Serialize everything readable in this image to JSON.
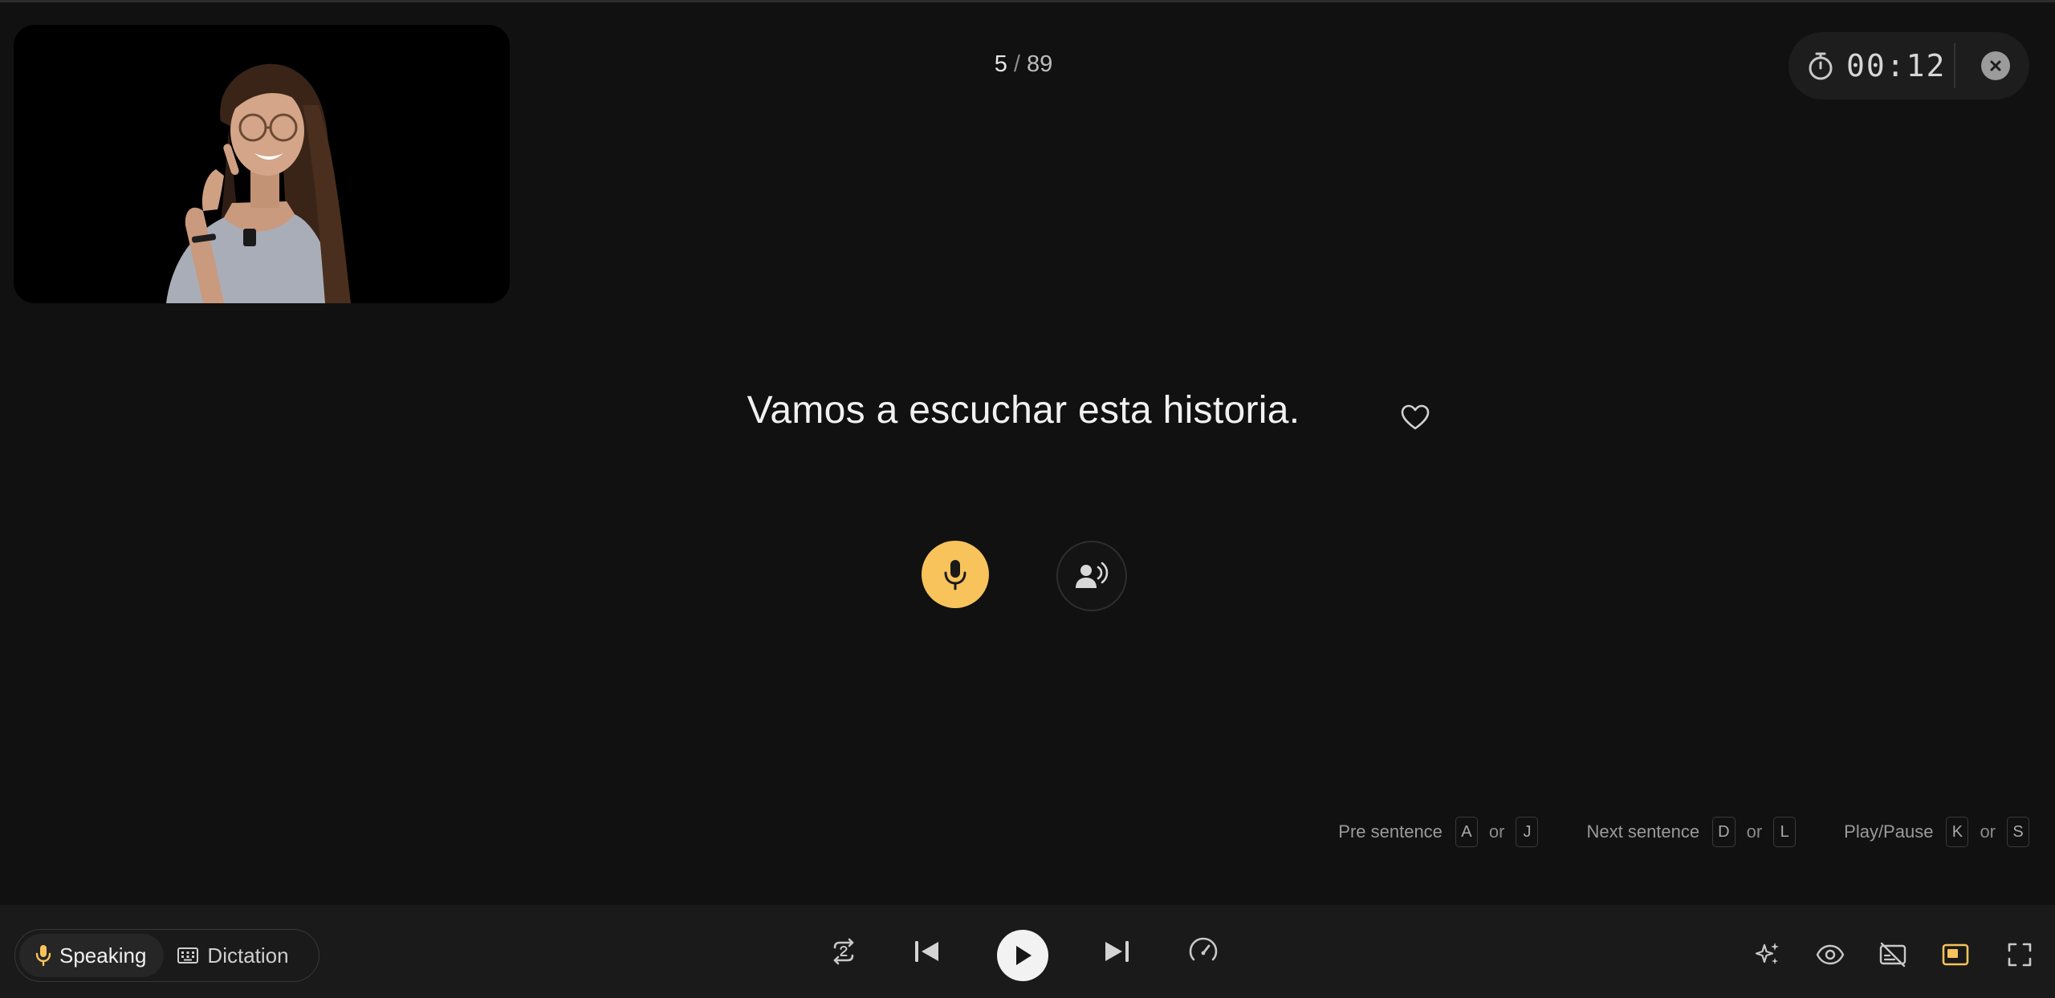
{
  "progress": {
    "current": "5",
    "separator": "/",
    "total": "89"
  },
  "timer": {
    "value": "00:12",
    "icon": "stopwatch-icon"
  },
  "sentence": {
    "text": "Vamos a escuchar esta historia."
  },
  "shortcuts": [
    {
      "label": "Pre sentence",
      "key1": "A",
      "or": "or",
      "key2": "J"
    },
    {
      "label": "Next sentence",
      "key1": "D",
      "or": "or",
      "key2": "L"
    },
    {
      "label": "Play/Pause",
      "key1": "K",
      "or": "or",
      "key2": "S"
    }
  ],
  "modes": {
    "speaking": "Speaking",
    "dictation": "Dictation",
    "active": "speaking"
  },
  "colors": {
    "accent": "#f7c35a",
    "background": "#111111",
    "bar": "#1a1a1a"
  },
  "icons": {
    "record": "microphone-icon",
    "listen": "speaker-person-icon",
    "repeat": "repeat-2-icon",
    "previous": "skip-previous-icon",
    "play": "play-icon",
    "next": "skip-next-icon",
    "speed": "speedometer-icon",
    "ai": "sparkles-icon",
    "view": "eye-icon",
    "subtitles_off": "subtitles-off-icon",
    "layout": "layout-icon",
    "fullscreen": "fullscreen-icon"
  }
}
